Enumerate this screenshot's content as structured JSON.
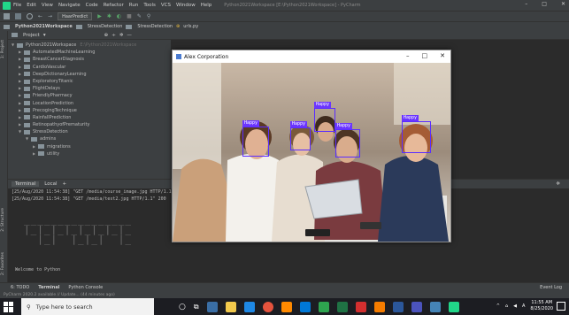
{
  "ide": {
    "menu": [
      "File",
      "Edit",
      "View",
      "Navigate",
      "Code",
      "Refactor",
      "Run",
      "Tools",
      "VCS",
      "Window",
      "Help"
    ],
    "window_title": "Python2021Workspace [E:\\Python2021Workspace] - PyCharm",
    "run_config": "HaarPredict",
    "breadcrumb": [
      "Python2021Workspace",
      "StressDetection",
      "StressDetection",
      "urls.py"
    ],
    "project_label": "Project",
    "tree": [
      {
        "label": "Python2021Workspace",
        "path": "E:\\Python2021Workspace",
        "indent": 0,
        "open": true
      },
      {
        "label": "AutomatedMachineLearning",
        "indent": 1
      },
      {
        "label": "BreastCancerDiagnosis",
        "indent": 1
      },
      {
        "label": "CardioVascular",
        "indent": 1
      },
      {
        "label": "DeepDictionaryLearning",
        "indent": 1
      },
      {
        "label": "ExploratoryTitanic",
        "indent": 1
      },
      {
        "label": "FlightDelays",
        "indent": 1
      },
      {
        "label": "FriendlyPharmacy",
        "indent": 1
      },
      {
        "label": "LocationPrediction",
        "indent": 1
      },
      {
        "label": "PrecogingTechnique",
        "indent": 1
      },
      {
        "label": "RainfallPrediction",
        "indent": 1
      },
      {
        "label": "RetinopathyofPrematurity",
        "indent": 1
      },
      {
        "label": "StressDetection",
        "indent": 1,
        "open": true
      },
      {
        "label": "admins",
        "indent": 2,
        "open": true
      },
      {
        "label": "migrations",
        "indent": 3
      },
      {
        "label": "utility",
        "indent": 3
      }
    ],
    "side_labels": [
      "1: Project",
      "2: Structure",
      "2: Favorites"
    ],
    "terminal": {
      "tabs": [
        "Terminal",
        "Local"
      ],
      "lines": [
        "[25/Aug/2020 11:54:38] \"GET /media/course_image.jpg HTTP/1.1\" 200",
        "[25/Aug/2020 11:54:38] \"GET /media/test2.jpg HTTP/1.1\" 200"
      ],
      "ascii_art": "________________\n|_|_|_|_|_|_|_|_\n  |_|  |_|_|  |_",
      "welcome": "Welcome to Python"
    },
    "bottom_tabs": [
      "6: TODO",
      "Terminal",
      "Python Console"
    ],
    "event_log": "Event Log",
    "status": "PyCharm 2020.2 available // Update... (44 minutes ago)"
  },
  "window": {
    "title": "Alex Corporation",
    "labels": [
      "Happy",
      "Happy",
      "Happy",
      "Happy",
      "Happy"
    ]
  },
  "taskbar": {
    "search_placeholder": "Type here to search",
    "time": "11:55 AM",
    "date": "8/25/2020"
  }
}
